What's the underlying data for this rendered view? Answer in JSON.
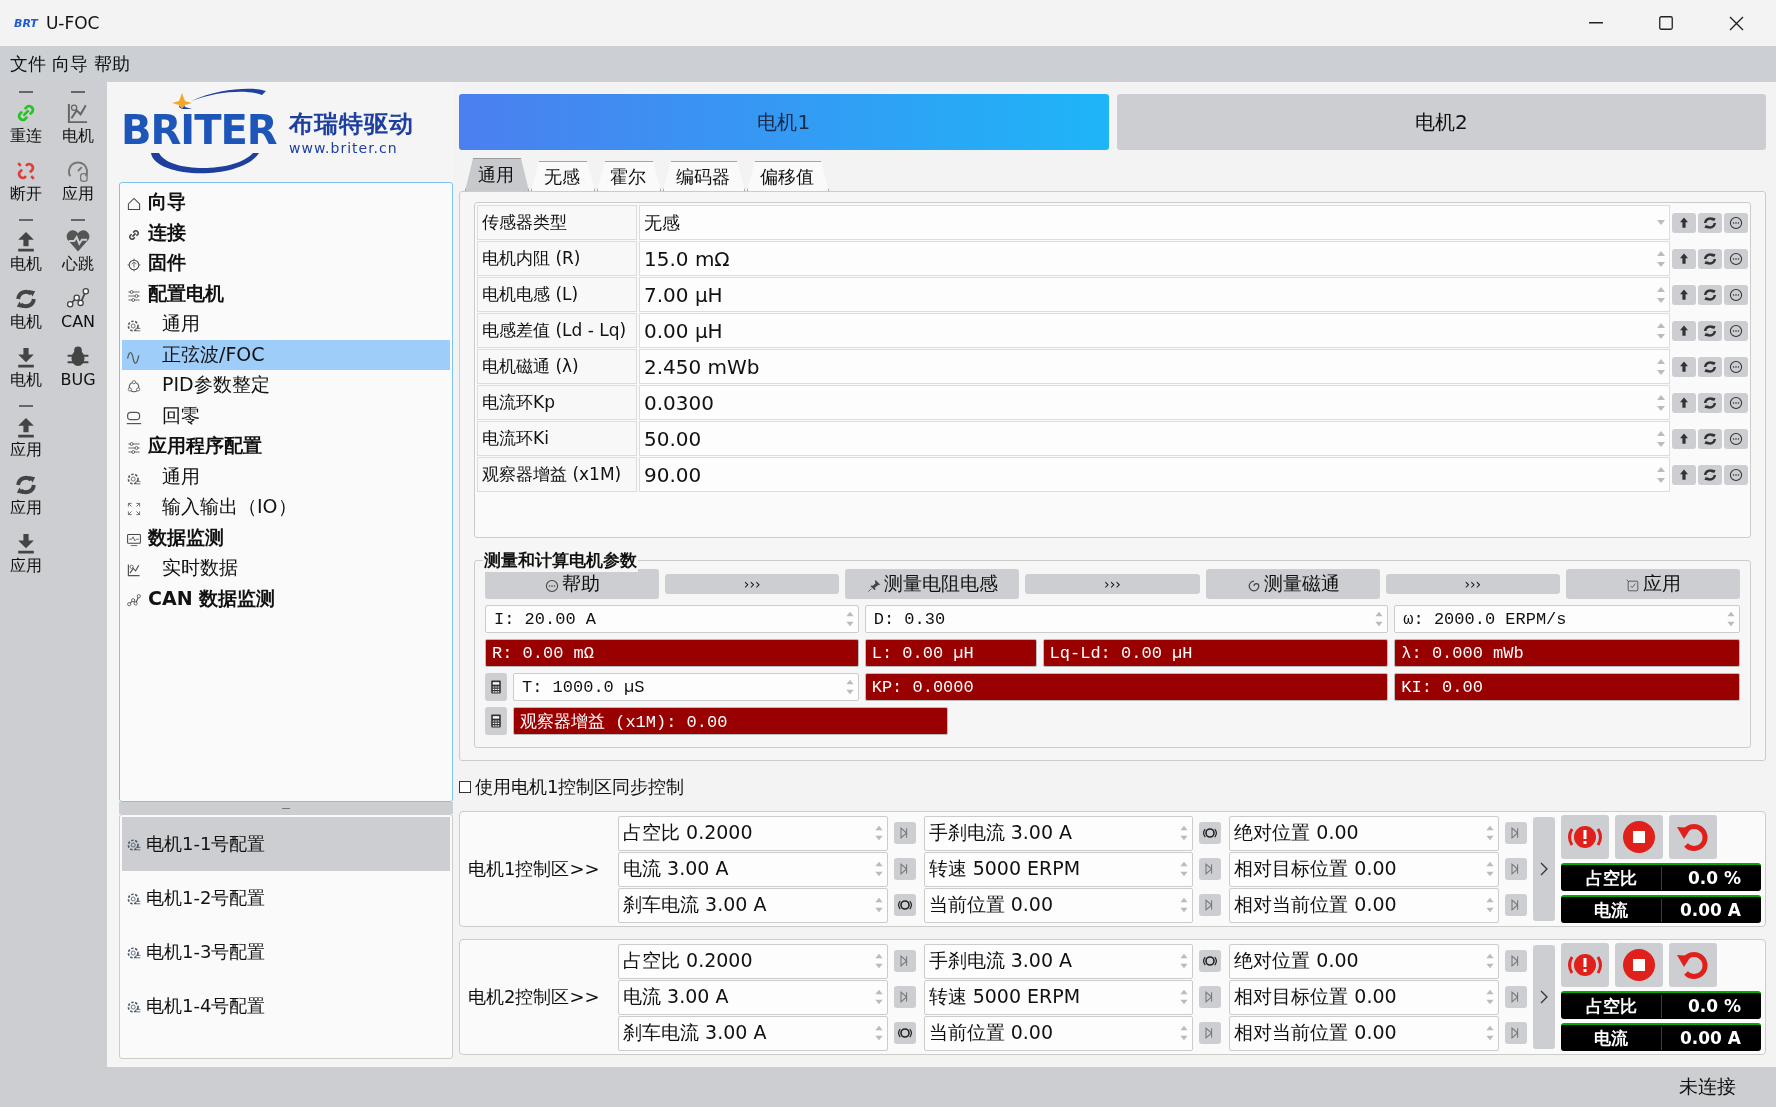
{
  "window": {
    "logo": "BRT",
    "title": "U-FOC"
  },
  "menu": [
    "文件",
    "向导",
    "帮助"
  ],
  "toolbar": [
    [
      "重连",
      "电机",
      "断开",
      "应用"
    ],
    [
      "电机",
      "心跳",
      "电机",
      "CAN",
      "电机",
      "BUG"
    ],
    [
      "应用",
      "应用",
      "应用"
    ]
  ],
  "brand": {
    "name": "BRITER",
    "cn": "布瑞特驱动",
    "url": "www.briter.cn"
  },
  "tree": [
    {
      "label": "向导",
      "selected": false
    },
    {
      "label": "连接",
      "selected": false
    },
    {
      "label": "固件",
      "selected": false
    },
    {
      "label": "配置电机",
      "selected": false,
      "children": [
        {
          "label": "通用",
          "selected": false
        },
        {
          "label": "正弦波/FOC",
          "selected": true
        },
        {
          "label": "PID参数整定",
          "selected": false
        },
        {
          "label": "回零",
          "selected": false
        }
      ]
    },
    {
      "label": "应用程序配置",
      "selected": false,
      "children": [
        {
          "label": "通用",
          "selected": false
        },
        {
          "label": "输入输出（IO）",
          "selected": false
        }
      ]
    },
    {
      "label": "数据监测",
      "selected": false,
      "children": [
        {
          "label": "实时数据",
          "selected": false
        }
      ]
    },
    {
      "label": "CAN 数据监测",
      "selected": false
    }
  ],
  "configs": [
    {
      "label": "电机1-1号配置",
      "selected": true
    },
    {
      "label": "电机1-2号配置",
      "selected": false
    },
    {
      "label": "电机1-3号配置",
      "selected": false
    },
    {
      "label": "电机1-4号配置",
      "selected": false
    }
  ],
  "motor_tabs": [
    {
      "label": "电机1",
      "selected": true
    },
    {
      "label": "电机2",
      "selected": false
    }
  ],
  "sub_tabs": [
    {
      "label": "通用",
      "selected": true
    },
    {
      "label": "无感",
      "selected": false
    },
    {
      "label": "霍尔",
      "selected": false
    },
    {
      "label": "编码器",
      "selected": false
    },
    {
      "label": "偏移值",
      "selected": false
    }
  ],
  "params": [
    {
      "label": "传感器类型",
      "value": "无感",
      "kind": "combo"
    },
    {
      "label": "电机内阻 (R)",
      "value": "15.0 mΩ",
      "kind": "spin"
    },
    {
      "label": "电机电感 (L)",
      "value": "7.00 µH",
      "kind": "spin"
    },
    {
      "label": "电感差值 (Ld - Lq)",
      "value": "0.00 µH",
      "kind": "spin"
    },
    {
      "label": "电机磁通 (λ)",
      "value": "2.450 mWb",
      "kind": "spin"
    },
    {
      "label": "电流环Kp",
      "value": "0.0300",
      "kind": "spin"
    },
    {
      "label": "电流环Ki",
      "value": "50.00",
      "kind": "spin"
    },
    {
      "label": "观察器增益 (x1M)",
      "value": "90.00",
      "kind": "spin"
    }
  ],
  "measure": {
    "title": "测量和计算电机参数",
    "buttons": [
      {
        "label": "帮助",
        "kind": "action"
      },
      {
        "label": "›››",
        "kind": "step"
      },
      {
        "label": "测量电阻电感",
        "kind": "action"
      },
      {
        "label": "›››",
        "kind": "step"
      },
      {
        "label": "测量磁通",
        "kind": "action"
      },
      {
        "label": "›››",
        "kind": "step"
      },
      {
        "label": "应用",
        "kind": "action"
      }
    ],
    "inputs": [
      "I: 20.00 A",
      "D: 0.30",
      "ω: 2000.0 ERPM/s",
      "T: 1000.0 µS"
    ],
    "results": [
      "R: 0.00 mΩ",
      "L: 0.00 µH",
      "Lq-Ld: 0.00 µH",
      "λ: 0.000 mWb",
      "KP: 0.0000",
      "KI: 0.00",
      "观察器增益 (x1M): 0.00"
    ]
  },
  "sync": {
    "label": "使用电机1控制区同步控制",
    "checked": false
  },
  "controls": [
    {
      "title": "电机1控制区>>",
      "fields": [
        {
          "value": "占空比 0.2000",
          "kind": "play"
        },
        {
          "value": "手刹电流 3.00 A",
          "kind": "brake"
        },
        {
          "value": "绝对位置 0.00",
          "kind": "play"
        },
        {
          "value": "电流 3.00 A",
          "kind": "play"
        },
        {
          "value": "转速 5000 ERPM",
          "kind": "play"
        },
        {
          "value": "相对目标位置 0.00",
          "kind": "play"
        },
        {
          "value": "刹车电流 3.00 A",
          "kind": "brake"
        },
        {
          "value": "当前位置 0.00",
          "kind": "play"
        },
        {
          "value": "相对当前位置 0.00",
          "kind": "play"
        }
      ],
      "meters": [
        {
          "label": "占空比",
          "value": "0.0 %"
        },
        {
          "label": "电流",
          "value": "0.00 A"
        }
      ]
    },
    {
      "title": "电机2控制区>>",
      "fields": [
        {
          "value": "占空比 0.2000",
          "kind": "play"
        },
        {
          "value": "手刹电流 3.00 A",
          "kind": "brake"
        },
        {
          "value": "绝对位置 0.00",
          "kind": "play"
        },
        {
          "value": "电流 3.00 A",
          "kind": "play"
        },
        {
          "value": "转速 5000 ERPM",
          "kind": "play"
        },
        {
          "value": "相对目标位置 0.00",
          "kind": "play"
        },
        {
          "value": "刹车电流 3.00 A",
          "kind": "brake"
        },
        {
          "value": "当前位置 0.00",
          "kind": "play"
        },
        {
          "value": "相对当前位置 0.00",
          "kind": "play"
        }
      ],
      "meters": [
        {
          "label": "占空比",
          "value": "0.0 %"
        },
        {
          "label": "电流",
          "value": "0.00 A"
        }
      ]
    }
  ],
  "status_bar": "未连接"
}
